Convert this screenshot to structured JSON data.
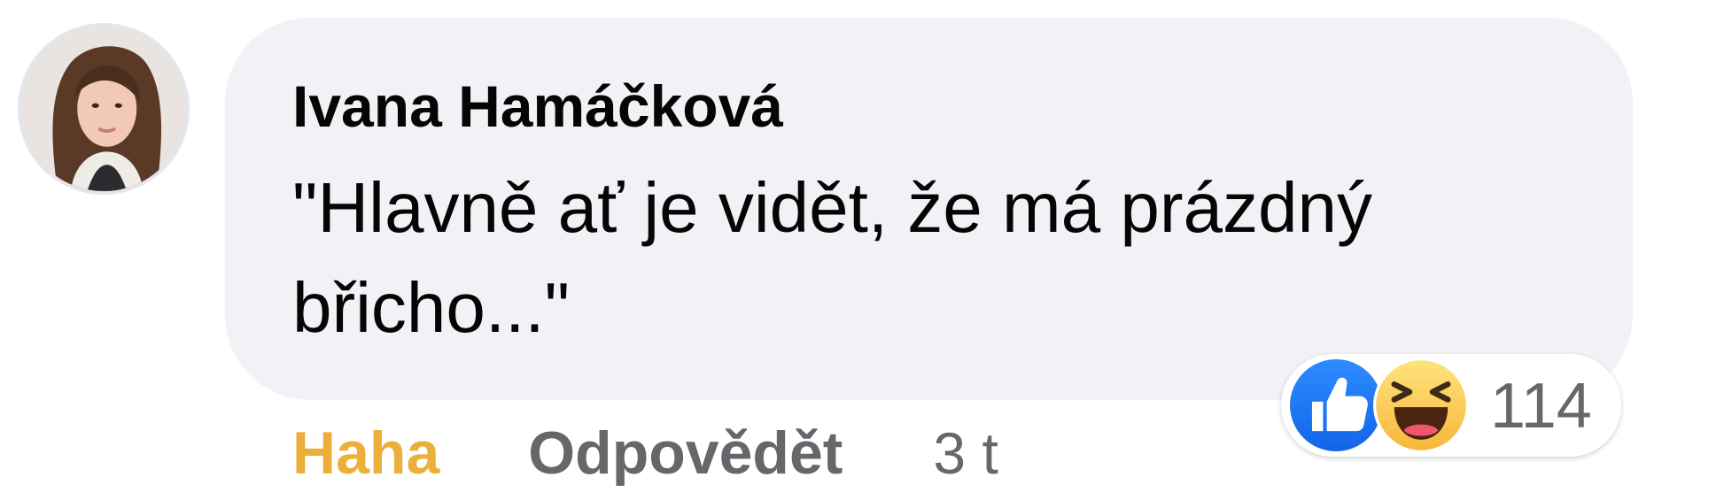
{
  "comment": {
    "author": "Ivana Hamáčková",
    "text": "\"Hlavně ať je vidět, že má prázdný břicho...\""
  },
  "actions": {
    "reaction_label": "Haha",
    "reply_label": "Odpovědět",
    "timestamp": "3 t"
  },
  "reactions": {
    "icons": [
      "like-icon",
      "haha-icon"
    ],
    "count": "114"
  },
  "colors": {
    "bubble": "#f0f2f5",
    "haha_active": "#ecb03a",
    "secondary_text": "#65676b",
    "like_blue": "#1877f2"
  }
}
